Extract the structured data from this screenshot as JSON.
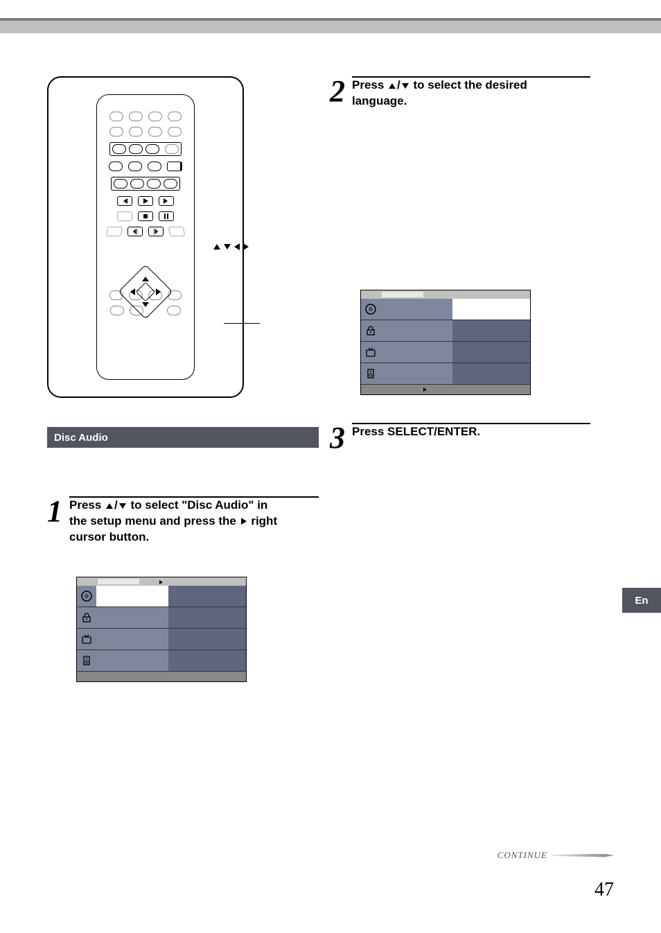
{
  "header": {},
  "remote": {
    "dpad_callout": "▲▼◄►"
  },
  "section": {
    "disc_audio_title": "Disc Audio"
  },
  "steps": {
    "s1": {
      "num": "1",
      "line1_a": "Press ",
      "line1_b": " to select \"Disc Audio\" in",
      "line2_a": "the setup menu and press the ",
      "line2_b": " right",
      "line3": "cursor button."
    },
    "s2": {
      "num": "2",
      "line1_a": "Press ",
      "line1_b": " to select the desired",
      "line2": "language."
    },
    "s3": {
      "num": "3",
      "text": "Press SELECT/ENTER."
    }
  },
  "menu1": {
    "rows": [
      {
        "icon": "disc",
        "label": "",
        "value": ""
      },
      {
        "icon": "lock",
        "label": "",
        "value": ""
      },
      {
        "icon": "tv",
        "label": "",
        "value": ""
      },
      {
        "icon": "speaker",
        "label": "",
        "value": ""
      }
    ]
  },
  "menu2": {
    "rows": [
      {
        "icon": "disc",
        "label": "",
        "value": ""
      },
      {
        "icon": "lock",
        "label": "",
        "value": ""
      },
      {
        "icon": "tv",
        "label": "",
        "value": ""
      },
      {
        "icon": "speaker",
        "label": "",
        "value": ""
      }
    ]
  },
  "side": {
    "lang_badge": "En"
  },
  "footer": {
    "continue": "CONTINUE",
    "page": "47"
  }
}
